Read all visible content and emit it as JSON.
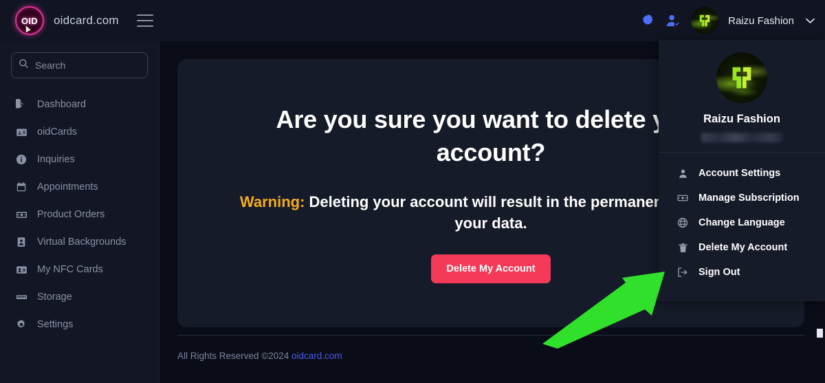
{
  "app": {
    "brand_name": "oidcard.com",
    "logo_text": "OID"
  },
  "topbar": {
    "menu_toggle_label": "Menu",
    "settings_icon": "gear-icon",
    "user_check_icon": "user-check-icon",
    "user_name": "Raizu Fashion",
    "chevron": "⌄"
  },
  "sidebar": {
    "search": {
      "placeholder": "Search",
      "value": "",
      "icon": "search-icon"
    },
    "items": [
      {
        "label": "Dashboard",
        "icon": "pie-chart-icon"
      },
      {
        "label": "oidCards",
        "icon": "id-card-icon"
      },
      {
        "label": "Inquiries",
        "icon": "info-circle-icon"
      },
      {
        "label": "Appointments",
        "icon": "calendar-icon"
      },
      {
        "label": "Product Orders",
        "icon": "banknote-icon"
      },
      {
        "label": "Virtual Backgrounds",
        "icon": "portrait-icon"
      },
      {
        "label": "My NFC Cards",
        "icon": "contact-card-icon"
      },
      {
        "label": "Storage",
        "icon": "memory-icon"
      },
      {
        "label": "Settings",
        "icon": "gear-icon"
      }
    ]
  },
  "main": {
    "title": "Are you sure you want to delete your account?",
    "warning_label": "Warning:",
    "warning_text": "Deleting your account will result in the permanent loss of all your data.",
    "delete_button": "Delete My Account"
  },
  "footer": {
    "text": "All Rights Reserved ©2024 ",
    "link": "oidcard.com"
  },
  "dropdown": {
    "user_name": "Raizu Fashion",
    "email_redacted": true,
    "items": [
      {
        "label": "Account Settings",
        "icon": "person-icon"
      },
      {
        "label": "Manage Subscription",
        "icon": "banknote-icon"
      },
      {
        "label": "Change Language",
        "icon": "globe-icon"
      },
      {
        "label": "Delete My Account",
        "icon": "trash-icon"
      },
      {
        "label": "Sign Out",
        "icon": "sign-out-icon"
      }
    ]
  },
  "annotation": {
    "arrow_color": "#30e02a",
    "arrow_target": "Sign Out"
  },
  "colors": {
    "page_background": "#0a0d18",
    "panel_background": "#161b29",
    "sidebar_background": "#121625",
    "accent_danger": "#f43a58",
    "accent_warning": "#f5ac1d",
    "accent_link": "#4e5bef",
    "brand_pink": "#e0319b",
    "header_icon_blue": "#4f6ef7"
  }
}
